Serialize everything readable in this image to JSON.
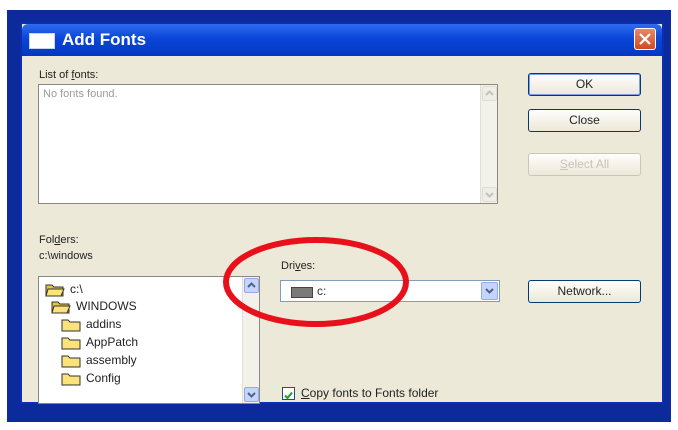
{
  "dialog": {
    "title": "Add Fonts",
    "fonts_label_pre": "List of ",
    "fonts_label_key": "f",
    "fonts_label_post": "onts:",
    "fonts_empty": "No fonts found.",
    "folders_label_pre": "Fol",
    "folders_label_key": "d",
    "folders_label_post": "ers:",
    "current_folder": "c:\\windows",
    "drives_label_pre": "Dri",
    "drives_label_key": "v",
    "drives_label_post": "es:",
    "drive_value": "c:",
    "copy_key": "C",
    "copy_post": "opy fonts to Fonts folder",
    "copy_checked": true
  },
  "buttons": {
    "ok": "OK",
    "close": "Close",
    "select_all_pre": "",
    "select_all_key": "S",
    "select_all_post": "elect All",
    "network": "Network..."
  },
  "folders": [
    {
      "label": "c:\\",
      "icon": "open-folder-icon"
    },
    {
      "label": "WINDOWS",
      "icon": "open-folder-icon"
    },
    {
      "label": "addins",
      "icon": "folder-icon"
    },
    {
      "label": "AppPatch",
      "icon": "folder-icon"
    },
    {
      "label": "assembly",
      "icon": "folder-icon"
    },
    {
      "label": "Config",
      "icon": "folder-icon"
    }
  ],
  "colors": {
    "frame": "#0c2a9c",
    "titlebar": "#0a46d8",
    "dialog_face": "#ece9d8",
    "annotation": "#e8101a"
  }
}
